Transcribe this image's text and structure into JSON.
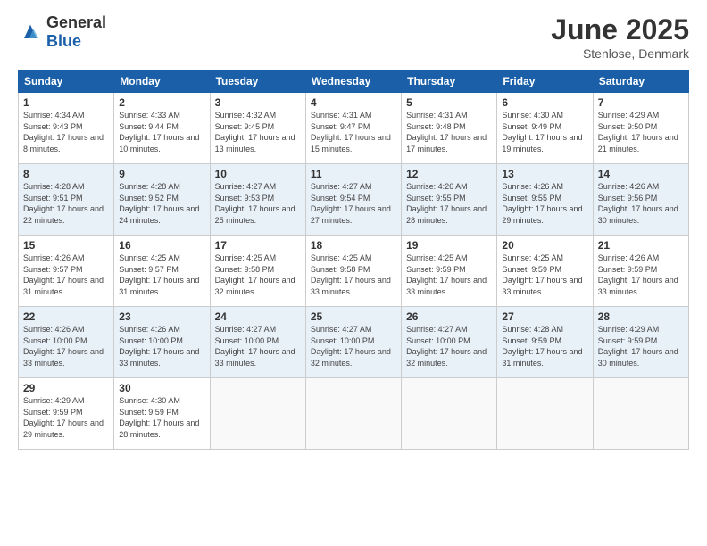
{
  "header": {
    "logo_general": "General",
    "logo_blue": "Blue",
    "title": "June 2025",
    "subtitle": "Stenlose, Denmark"
  },
  "calendar": {
    "days_of_week": [
      "Sunday",
      "Monday",
      "Tuesday",
      "Wednesday",
      "Thursday",
      "Friday",
      "Saturday"
    ],
    "weeks": [
      [
        {
          "day": "1",
          "sunrise": "Sunrise: 4:34 AM",
          "sunset": "Sunset: 9:43 PM",
          "daylight": "Daylight: 17 hours and 8 minutes."
        },
        {
          "day": "2",
          "sunrise": "Sunrise: 4:33 AM",
          "sunset": "Sunset: 9:44 PM",
          "daylight": "Daylight: 17 hours and 10 minutes."
        },
        {
          "day": "3",
          "sunrise": "Sunrise: 4:32 AM",
          "sunset": "Sunset: 9:45 PM",
          "daylight": "Daylight: 17 hours and 13 minutes."
        },
        {
          "day": "4",
          "sunrise": "Sunrise: 4:31 AM",
          "sunset": "Sunset: 9:47 PM",
          "daylight": "Daylight: 17 hours and 15 minutes."
        },
        {
          "day": "5",
          "sunrise": "Sunrise: 4:31 AM",
          "sunset": "Sunset: 9:48 PM",
          "daylight": "Daylight: 17 hours and 17 minutes."
        },
        {
          "day": "6",
          "sunrise": "Sunrise: 4:30 AM",
          "sunset": "Sunset: 9:49 PM",
          "daylight": "Daylight: 17 hours and 19 minutes."
        },
        {
          "day": "7",
          "sunrise": "Sunrise: 4:29 AM",
          "sunset": "Sunset: 9:50 PM",
          "daylight": "Daylight: 17 hours and 21 minutes."
        }
      ],
      [
        {
          "day": "8",
          "sunrise": "Sunrise: 4:28 AM",
          "sunset": "Sunset: 9:51 PM",
          "daylight": "Daylight: 17 hours and 22 minutes."
        },
        {
          "day": "9",
          "sunrise": "Sunrise: 4:28 AM",
          "sunset": "Sunset: 9:52 PM",
          "daylight": "Daylight: 17 hours and 24 minutes."
        },
        {
          "day": "10",
          "sunrise": "Sunrise: 4:27 AM",
          "sunset": "Sunset: 9:53 PM",
          "daylight": "Daylight: 17 hours and 25 minutes."
        },
        {
          "day": "11",
          "sunrise": "Sunrise: 4:27 AM",
          "sunset": "Sunset: 9:54 PM",
          "daylight": "Daylight: 17 hours and 27 minutes."
        },
        {
          "day": "12",
          "sunrise": "Sunrise: 4:26 AM",
          "sunset": "Sunset: 9:55 PM",
          "daylight": "Daylight: 17 hours and 28 minutes."
        },
        {
          "day": "13",
          "sunrise": "Sunrise: 4:26 AM",
          "sunset": "Sunset: 9:55 PM",
          "daylight": "Daylight: 17 hours and 29 minutes."
        },
        {
          "day": "14",
          "sunrise": "Sunrise: 4:26 AM",
          "sunset": "Sunset: 9:56 PM",
          "daylight": "Daylight: 17 hours and 30 minutes."
        }
      ],
      [
        {
          "day": "15",
          "sunrise": "Sunrise: 4:26 AM",
          "sunset": "Sunset: 9:57 PM",
          "daylight": "Daylight: 17 hours and 31 minutes."
        },
        {
          "day": "16",
          "sunrise": "Sunrise: 4:25 AM",
          "sunset": "Sunset: 9:57 PM",
          "daylight": "Daylight: 17 hours and 31 minutes."
        },
        {
          "day": "17",
          "sunrise": "Sunrise: 4:25 AM",
          "sunset": "Sunset: 9:58 PM",
          "daylight": "Daylight: 17 hours and 32 minutes."
        },
        {
          "day": "18",
          "sunrise": "Sunrise: 4:25 AM",
          "sunset": "Sunset: 9:58 PM",
          "daylight": "Daylight: 17 hours and 33 minutes."
        },
        {
          "day": "19",
          "sunrise": "Sunrise: 4:25 AM",
          "sunset": "Sunset: 9:59 PM",
          "daylight": "Daylight: 17 hours and 33 minutes."
        },
        {
          "day": "20",
          "sunrise": "Sunrise: 4:25 AM",
          "sunset": "Sunset: 9:59 PM",
          "daylight": "Daylight: 17 hours and 33 minutes."
        },
        {
          "day": "21",
          "sunrise": "Sunrise: 4:26 AM",
          "sunset": "Sunset: 9:59 PM",
          "daylight": "Daylight: 17 hours and 33 minutes."
        }
      ],
      [
        {
          "day": "22",
          "sunrise": "Sunrise: 4:26 AM",
          "sunset": "Sunset: 10:00 PM",
          "daylight": "Daylight: 17 hours and 33 minutes."
        },
        {
          "day": "23",
          "sunrise": "Sunrise: 4:26 AM",
          "sunset": "Sunset: 10:00 PM",
          "daylight": "Daylight: 17 hours and 33 minutes."
        },
        {
          "day": "24",
          "sunrise": "Sunrise: 4:27 AM",
          "sunset": "Sunset: 10:00 PM",
          "daylight": "Daylight: 17 hours and 33 minutes."
        },
        {
          "day": "25",
          "sunrise": "Sunrise: 4:27 AM",
          "sunset": "Sunset: 10:00 PM",
          "daylight": "Daylight: 17 hours and 32 minutes."
        },
        {
          "day": "26",
          "sunrise": "Sunrise: 4:27 AM",
          "sunset": "Sunset: 10:00 PM",
          "daylight": "Daylight: 17 hours and 32 minutes."
        },
        {
          "day": "27",
          "sunrise": "Sunrise: 4:28 AM",
          "sunset": "Sunset: 9:59 PM",
          "daylight": "Daylight: 17 hours and 31 minutes."
        },
        {
          "day": "28",
          "sunrise": "Sunrise: 4:29 AM",
          "sunset": "Sunset: 9:59 PM",
          "daylight": "Daylight: 17 hours and 30 minutes."
        }
      ],
      [
        {
          "day": "29",
          "sunrise": "Sunrise: 4:29 AM",
          "sunset": "Sunset: 9:59 PM",
          "daylight": "Daylight: 17 hours and 29 minutes."
        },
        {
          "day": "30",
          "sunrise": "Sunrise: 4:30 AM",
          "sunset": "Sunset: 9:59 PM",
          "daylight": "Daylight: 17 hours and 28 minutes."
        },
        null,
        null,
        null,
        null,
        null
      ]
    ]
  }
}
